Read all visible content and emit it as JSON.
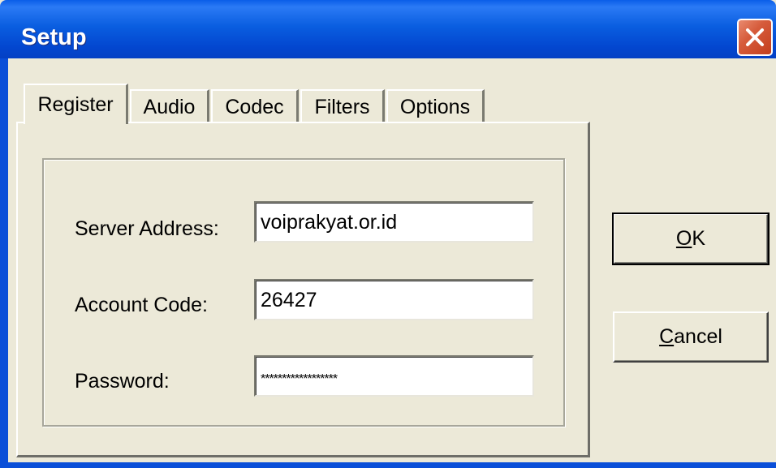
{
  "window": {
    "title": "Setup"
  },
  "tabs": [
    {
      "label": "Register",
      "active": true
    },
    {
      "label": "Audio",
      "active": false
    },
    {
      "label": "Codec",
      "active": false
    },
    {
      "label": "Filters",
      "active": false
    },
    {
      "label": "Options",
      "active": false
    }
  ],
  "form": {
    "server_address_label": "Server Address:",
    "server_address_value": "voiprakyat.or.id",
    "account_code_label": "Account Code:",
    "account_code_value": "26427",
    "password_label": "Password:",
    "password_value": "******************"
  },
  "buttons": {
    "ok_mnemonic": "O",
    "ok_rest": "K",
    "cancel_mnemonic": "C",
    "cancel_rest": "ancel"
  },
  "icons": {
    "close": "close-icon"
  },
  "colors": {
    "titlebar": "#0a5ee8",
    "close": "#d65c3c",
    "face": "#ece9d8"
  }
}
